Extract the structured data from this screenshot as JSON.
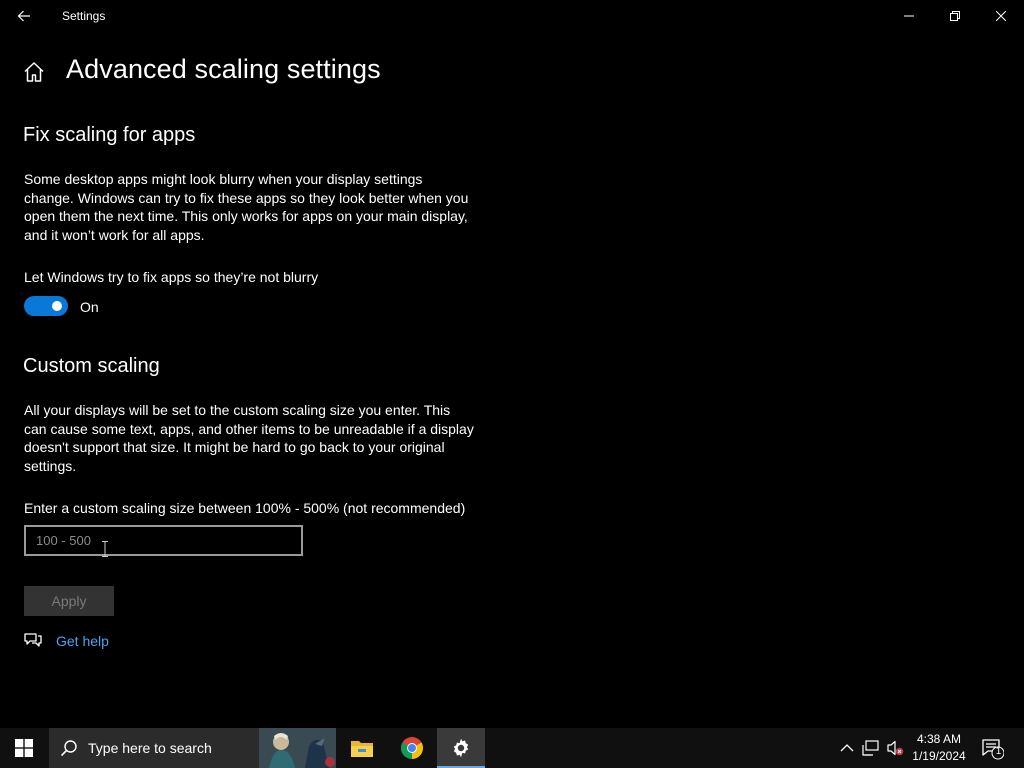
{
  "window": {
    "title": "Settings",
    "back_icon": "back-arrow-icon",
    "minimize_icon": "minimize-icon",
    "maximize_icon": "restore-icon",
    "close_icon": "close-icon"
  },
  "header": {
    "home_icon": "home-icon",
    "title": "Advanced scaling settings"
  },
  "fix_scaling": {
    "heading": "Fix scaling for apps",
    "description": "Some desktop apps might look blurry when your display settings change. Windows can try to fix these apps so they look better when you open them the next time. This only works for apps on your main display, and it won’t work for all apps.",
    "toggle_label": "Let Windows try to fix apps so they’re not blurry",
    "toggle_on": true,
    "toggle_state": "On"
  },
  "custom_scaling": {
    "heading": "Custom scaling",
    "description": "All your displays will be set to the custom scaling size you enter. This can cause some text, apps, and other items to be unreadable if a display doesn't support that size. It might be hard to go back to your original settings.",
    "input_label": "Enter a custom scaling size between 100% - 500% (not recommended)",
    "input_value": "",
    "input_placeholder": "100 - 500",
    "apply_label": "Apply",
    "apply_enabled": false
  },
  "help": {
    "icon": "chat-help-icon",
    "label": "Get help"
  },
  "taskbar": {
    "search_placeholder": "Type here to search",
    "apps": [
      "file-explorer-icon",
      "chrome-icon",
      "settings-gear-icon"
    ],
    "active_app": "Settings",
    "time": "4:38 AM",
    "date": "1/19/2024",
    "notification_count": "1"
  },
  "colors": {
    "background": "#000000",
    "accent": "#0a78d7",
    "link": "#4ba3f5",
    "taskbar": "#101010"
  }
}
